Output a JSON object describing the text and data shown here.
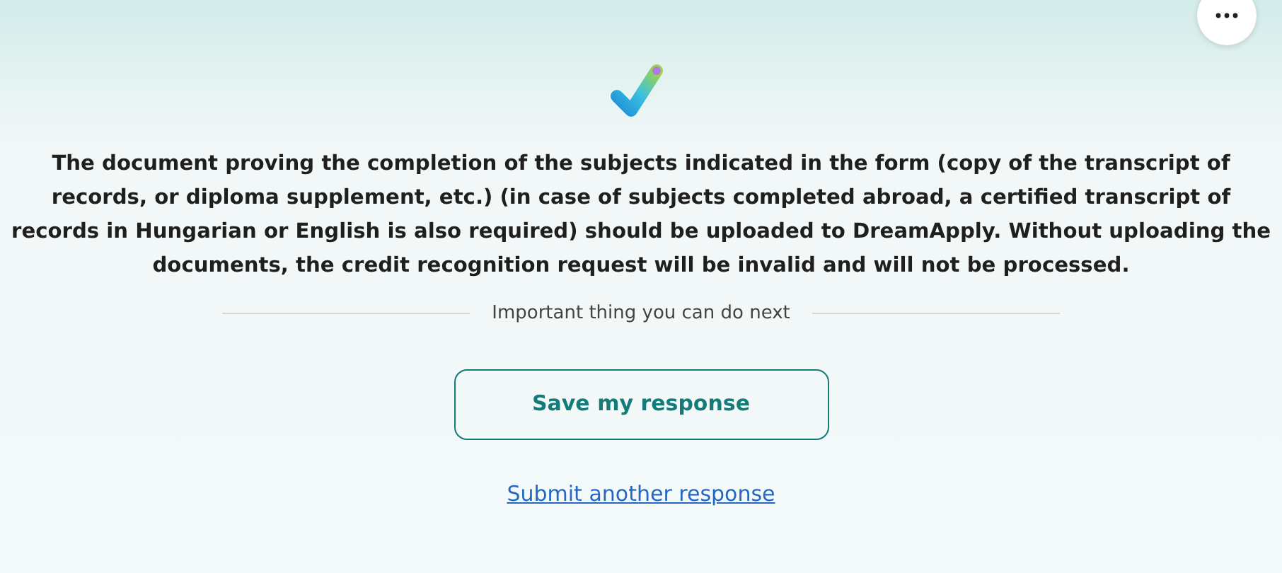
{
  "message": "The document proving the completion of the subjects indicated in the form (copy of the transcript of records, or diploma supplement, etc.) (in case of subjects completed abroad, a certified transcript of records in Hungarian or English is also required) should be uploaded to DreamApply. Without uploading the documents, the credit recognition request will be invalid and will not be processed.",
  "divider_label": "Important thing you can do next",
  "buttons": [
    {
      "kind": "outline",
      "label": "Save my response"
    },
    {
      "kind": "link",
      "label": "Submit another response"
    }
  ]
}
